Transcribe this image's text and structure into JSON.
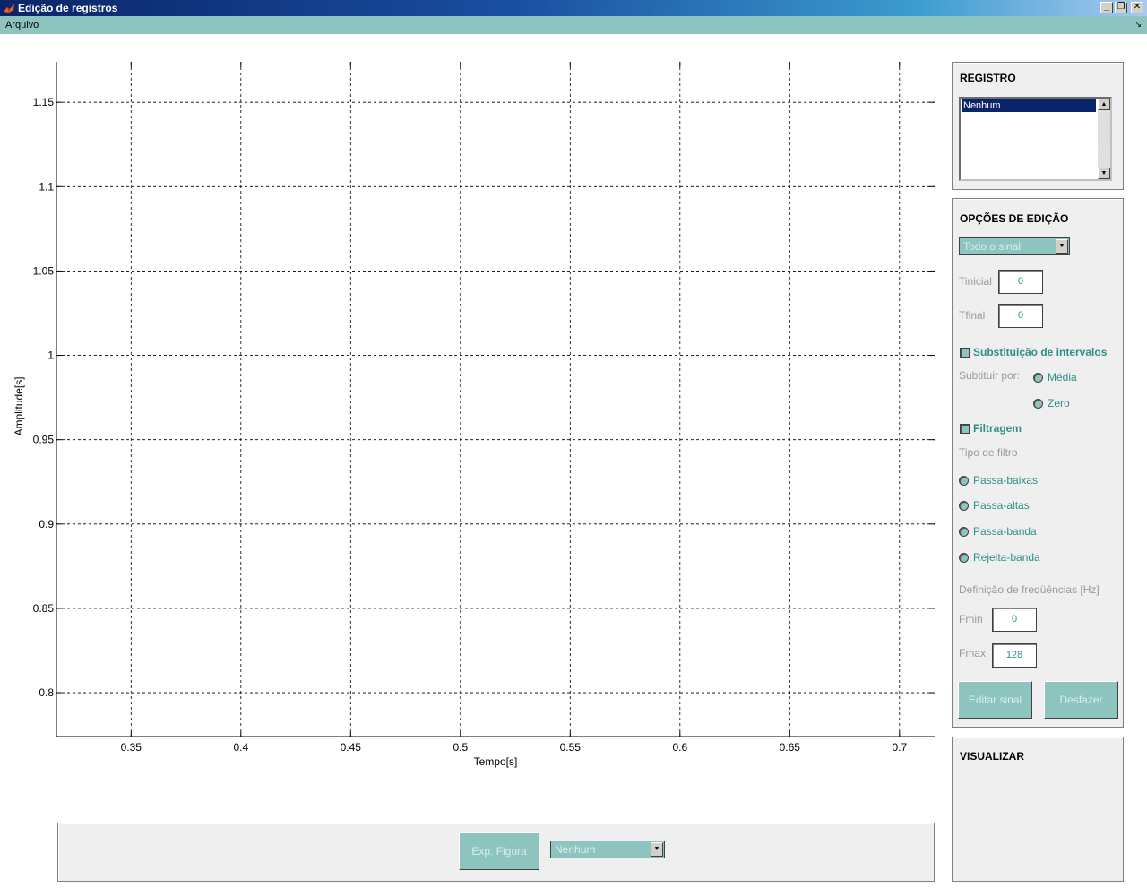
{
  "window": {
    "title": "Edição de registros"
  },
  "menubar": {
    "items": [
      {
        "label": "Arquivo"
      }
    ],
    "dock_icon": "dock-arrow-icon"
  },
  "chart_data": {
    "type": "line",
    "xlabel": "Tempo[s]",
    "ylabel": "Amplitude[s]",
    "xlim": [
      0.316,
      0.716
    ],
    "ylim": [
      0.774,
      1.174
    ],
    "xticks": [
      0.35,
      0.4,
      0.45,
      0.5,
      0.55,
      0.6,
      0.65,
      0.7
    ],
    "xtick_labels": [
      "0.35",
      "0.4",
      "0.45",
      "0.5",
      "0.55",
      "0.6",
      "0.65",
      "0.7"
    ],
    "yticks": [
      0.8,
      0.85,
      0.9,
      0.95,
      1.0,
      1.05,
      1.1,
      1.15
    ],
    "ytick_labels": [
      "0.8",
      "0.85",
      "0.9",
      "0.95",
      "1",
      "1.05",
      "1.1",
      "1.15"
    ],
    "grid": true,
    "series": []
  },
  "registro": {
    "title": "REGISTRO",
    "items": [
      "Nenhum"
    ],
    "selected": "Nenhum"
  },
  "opcoes": {
    "title": "OPÇÕES DE EDIÇÃO",
    "mode_select": "Todo o sinal",
    "tinicial_label": "Tinicial",
    "tinicial_value": "0",
    "tfinal_label": "Tfinal",
    "tfinal_value": "0",
    "substituicao_label": "Substituição de intervalos",
    "subtituir_por_label": "Subtituir por:",
    "media_label": "Média",
    "zero_label": "Zero",
    "filtragem_label": "Filtragem",
    "tipo_filtro_label": "Tipo de filtro",
    "filters": [
      "Passa-baixas",
      "Passa-altas",
      "Passa-banda",
      "Rejeita-banda"
    ],
    "freq_def_label": "Definição de freqüências [Hz]",
    "fmin_label": "Fmin",
    "fmin_value": "0",
    "fmax_label": "Fmax",
    "fmax_value": "128",
    "editar_label": "Editar sinal",
    "desfazer_label": "Desfazer"
  },
  "visualizar": {
    "title": "VISUALIZAR"
  },
  "bottom": {
    "export_label": "Exp. Figura",
    "figure_select": "Nenhum"
  },
  "colors": {
    "teal": "#8ec4c0",
    "teal_text": "#2f8f86",
    "titlebar": "#0a246a"
  }
}
